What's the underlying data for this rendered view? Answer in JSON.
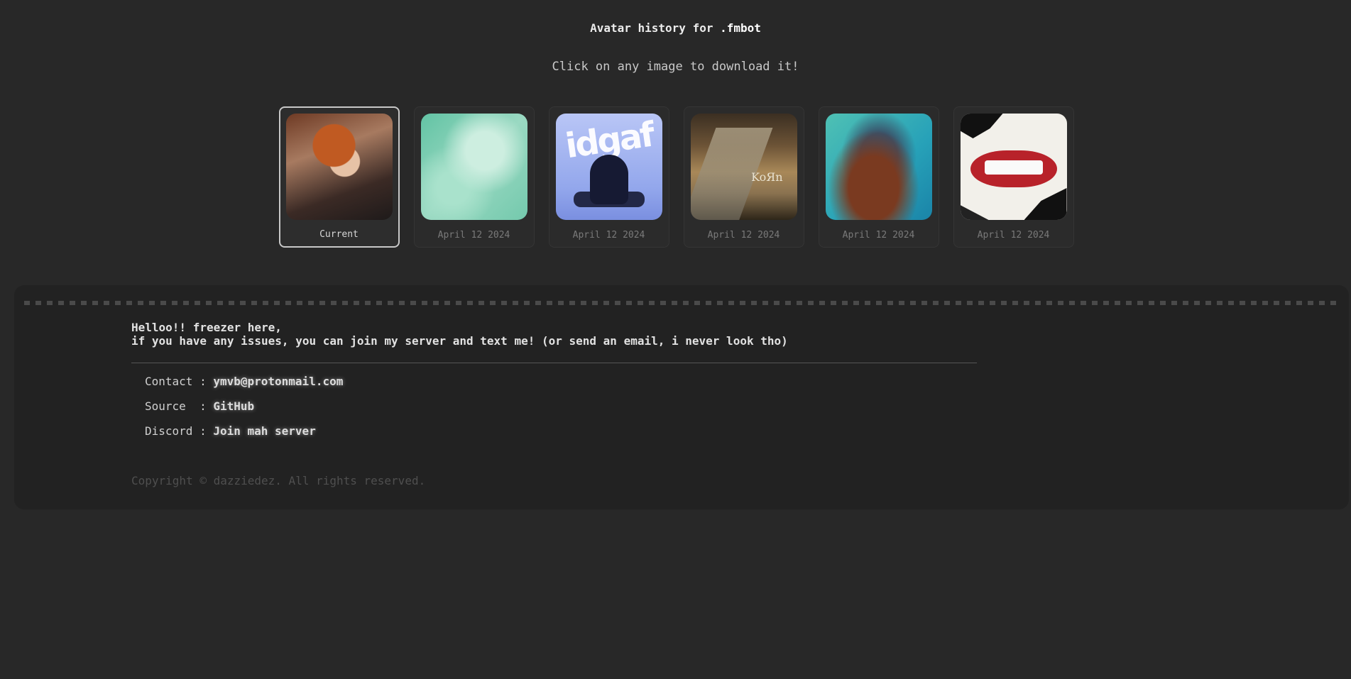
{
  "header": {
    "title_prefix": "Avatar history for",
    "bot_name": ".fmbot",
    "subtitle": "Click on any image to download it!"
  },
  "avatars": [
    {
      "label": "Current",
      "current": true,
      "art": "taylor-swift-red-album-cover"
    },
    {
      "label": "April 12 2024",
      "current": false,
      "art": "anime-mint-green"
    },
    {
      "label": "April 12 2024",
      "current": false,
      "art": "idgaf-hooded-figure"
    },
    {
      "label": "April 12 2024",
      "current": false,
      "art": "korn-follow-the-leader"
    },
    {
      "label": "April 12 2024",
      "current": false,
      "art": "blurred-figure-teal"
    },
    {
      "label": "April 12 2024",
      "current": false,
      "art": "greed-lips-collage"
    }
  ],
  "footer": {
    "greeting_line1": "Helloo!! freezer here,",
    "greeting_line2": "if you have any issues, you can join my server and text me! (or send an email, i never look tho)",
    "contact_label": "Contact : ",
    "contact_value": "ymvb@protonmail.com",
    "source_label": "Source  : ",
    "source_value": "GitHub",
    "discord_label": "Discord : ",
    "discord_value": "Join mah server",
    "copyright": "Copyright © dazziedez. All rights reserved."
  },
  "colors": {
    "background": "#282828",
    "panel": "#222222",
    "card_border_current": "#c8c8c8"
  }
}
